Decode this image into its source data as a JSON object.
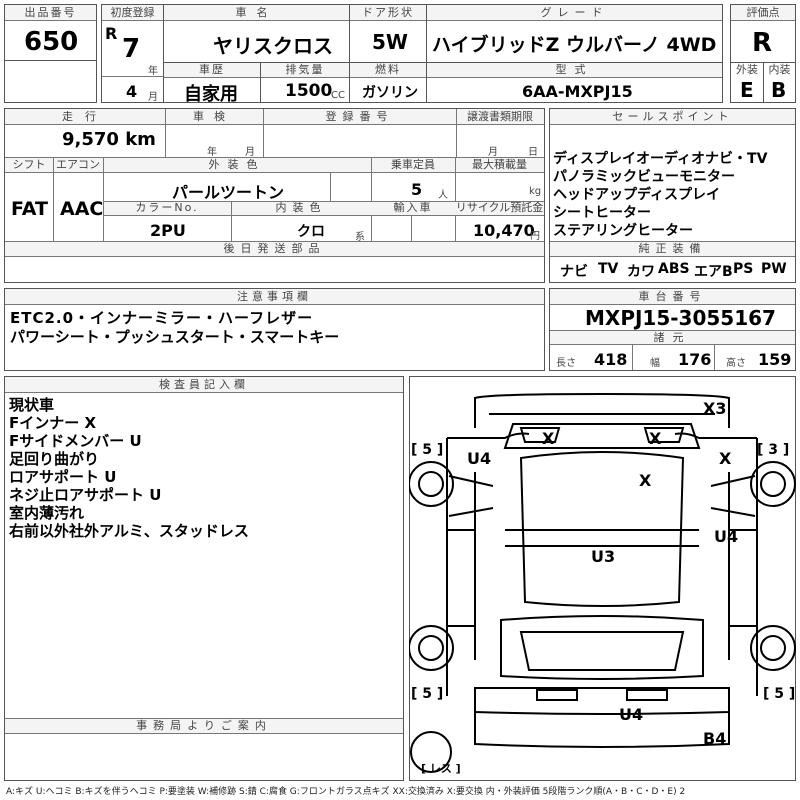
{
  "header": {
    "lot_label": "出品番号",
    "lot": "650",
    "reg_label": "初度登録",
    "era": "R",
    "year": "7",
    "year_unit": "年",
    "month": "4",
    "month_unit": "月",
    "name_label": "車名",
    "name": "ヤリスクロス",
    "door_label": "ドア形状",
    "door": "5W",
    "grade_label": "グレード",
    "grade": "ハイブリッドZ ウルバーノ 4WD",
    "score_label": "評価点",
    "score": "R",
    "history_label": "車歴",
    "history": "自家用",
    "disp_label": "排気量",
    "disp": "1500",
    "disp_unit": "CC",
    "fuel_label": "燃料",
    "fuel": "ガソリン",
    "model_label": "型式",
    "model": "6AA-MXPJ15",
    "ext_label": "外装",
    "ext": "E",
    "int_label": "内装",
    "int": "B"
  },
  "row2": {
    "mileage_label": "走行",
    "mileage": "9,570 km",
    "shaken_label": "車検",
    "shaken_year": "年",
    "shaken_month": "月",
    "regno_label": "登録番号",
    "transfer_label": "譲渡書類期限",
    "transfer_month": "月",
    "transfer_day": "日",
    "shift_label": "シフト",
    "shift": "FAT",
    "ac_label": "エアコン",
    "ac": "AAC",
    "color_label": "外装色",
    "color": "パールツートン",
    "capacity_label": "乗車定員",
    "capacity": "5",
    "capacity_unit": "人",
    "load_label": "最大積載量",
    "load_unit": "kg",
    "colorno_label": "カラーNo.",
    "colorno": "2PU",
    "interior_label": "内装色",
    "interior": "クロ",
    "interior_unit": "系",
    "import_label": "輸入車",
    "recycle_label": "リサイクル預託金",
    "recycle": "10,470",
    "recycle_unit": "円",
    "later_label": "後日発送部品"
  },
  "sales": {
    "label": "セールスポイント",
    "items": [
      "ディスプレイオーディオナビ・TV",
      "パノラミックビューモニター",
      "ヘッドアップディスプレイ",
      "シートヒーター",
      "ステアリングヒーター"
    ]
  },
  "equipment": {
    "label": "純正装備",
    "items": [
      "ナビ",
      "TV",
      "カワ",
      "ABS",
      "エアB",
      "PS",
      "PW"
    ]
  },
  "notes": {
    "label": "注意事項欄",
    "lines": [
      "ETC2.0・インナーミラー・ハーフレザー",
      "パワーシート・プッシュスタート・スマートキー"
    ]
  },
  "chassis": {
    "label": "車台番号",
    "value": "MXPJ15-3055167",
    "dim_label": "諸元",
    "length_label": "長さ",
    "length": "418",
    "width_label": "幅",
    "width": "176",
    "height_label": "高さ",
    "height": "159"
  },
  "inspector": {
    "label": "検査員記入欄",
    "lines": [
      "現状車",
      "Fインナー X",
      "Fサイドメンバー U",
      "足回り曲がり",
      "ロアサポート U",
      "ネジ止ロアサポート U",
      "室内薄汚れ",
      "右前以外社外アルミ、スタッドレス"
    ]
  },
  "office": {
    "label": "事務局よりご案内"
  },
  "diagram": {
    "marks": [
      "X3",
      "X",
      "X",
      "U4",
      "X",
      "X",
      "U4",
      "U3",
      "U4",
      "B4"
    ],
    "tires": [
      "[ 5 ]",
      "[ 3 ]",
      "[ 5 ]",
      "[ 5 ]"
    ],
    "spare": "[ レス ]"
  },
  "legend": "A:キズ U:ヘコミ B:キズを伴うヘコミ P:要塗装 W:補修跡 S:錆 C:腐食 G:フロントガラス点キズ XX:交換済み X:要交換 内・外装評価 5段階ランク順(A・B・C・D・E) 2"
}
